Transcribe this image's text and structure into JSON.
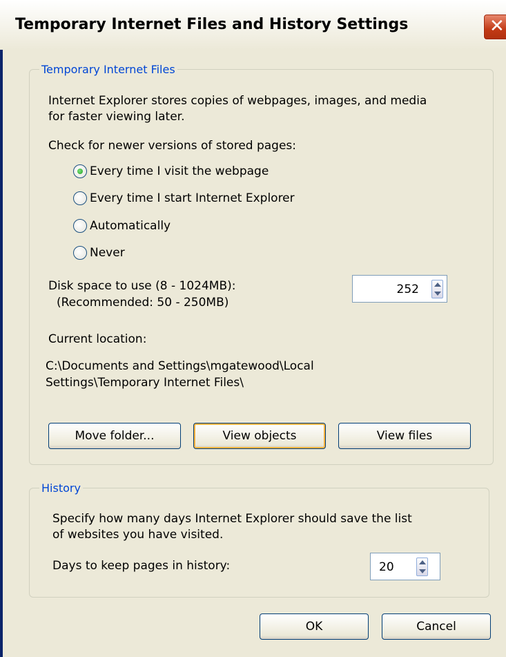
{
  "window": {
    "title": "Temporary Internet Files and History Settings"
  },
  "tif": {
    "legend": "Temporary Internet Files",
    "description_line1": "Internet Explorer stores copies of webpages, images, and media",
    "description_line2": "for faster viewing later.",
    "check_label": "Check for newer versions of stored pages:",
    "options": [
      {
        "label": "Every time I visit the webpage",
        "selected": true
      },
      {
        "label": "Every time I start Internet Explorer",
        "selected": false
      },
      {
        "label": "Automatically",
        "selected": false
      },
      {
        "label": "Never",
        "selected": false
      }
    ],
    "disk_label_line1": "Disk space to use (8 - 1024MB):",
    "disk_label_line2": "(Recommended: 50 - 250MB)",
    "disk_value": "252",
    "location_label": "Current location:",
    "location_line1": "C:\\Documents and Settings\\mgatewood\\Local",
    "location_line2": "Settings\\Temporary Internet Files\\",
    "buttons": {
      "move": "Move folder...",
      "view_objects": "View objects",
      "view_files": "View files"
    }
  },
  "history": {
    "legend": "History",
    "description_line1": "Specify how many days Internet Explorer should save the list",
    "description_line2": "of websites you have visited.",
    "days_label": "Days to keep pages in history:",
    "days_value": "20"
  },
  "footer": {
    "ok": "OK",
    "cancel": "Cancel"
  }
}
